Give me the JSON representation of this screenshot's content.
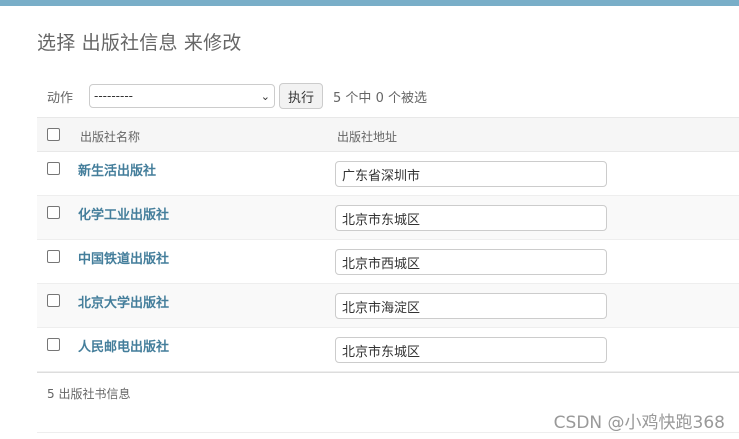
{
  "title": "选择 出版社信息 来修改",
  "actions": {
    "label": "动作",
    "select_value": "---------",
    "run_label": "执行",
    "counter": "5 个中 0 个被选"
  },
  "table": {
    "headers": {
      "name": "出版社名称",
      "address": "出版社地址"
    },
    "rows": [
      {
        "name": "新生活出版社",
        "address": "广东省深圳市"
      },
      {
        "name": "化学工业出版社",
        "address": "北京市东城区"
      },
      {
        "name": "中国铁道出版社",
        "address": "北京市西城区"
      },
      {
        "name": "北京大学出版社",
        "address": "北京市海淀区"
      },
      {
        "name": "人民邮电出版社",
        "address": "北京市东城区"
      }
    ]
  },
  "paginator": "5 出版社书信息",
  "watermark": "CSDN @小鸡快跑368",
  "colors": {
    "topbar": "#79aec8",
    "link": "#447e9b"
  },
  "icons": {
    "select_chevron": "chevron-down-icon"
  }
}
